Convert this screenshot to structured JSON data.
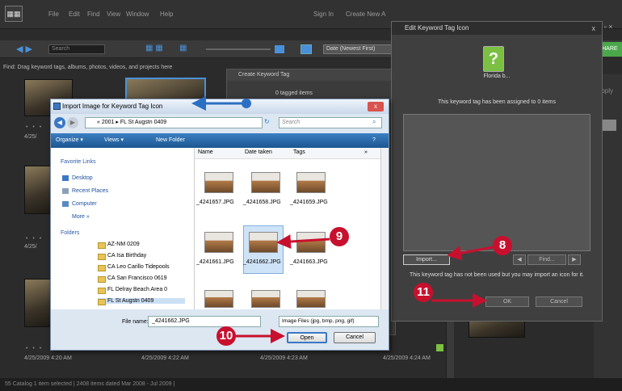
{
  "app": {
    "logo": "▦▦",
    "menu": [
      "File",
      "Edit",
      "Find",
      "View",
      "Window",
      "Help"
    ],
    "signin": "Sign In",
    "create_new": "Create New A",
    "search_placeholder": "Search",
    "sort": "Date (Newest First)",
    "find_bar": "Find: Drag keyword tags, albums, photos, videos, and projects here",
    "share": "SHARE",
    "apply": "Apply",
    "status": "55 Catalog   1 item selected  |  2408 items dated Mar 2008 - Jul 2009  |",
    "thumbs_dates": [
      "4/25/2009 4:20 AM",
      "4/25/2009 4:22 AM",
      "4/25/2009 4:23 AM",
      "4/25/2009 4:24 AM"
    ],
    "side_dates": [
      "4/25/",
      "4/25/"
    ]
  },
  "create_tag_dialog": {
    "title": "Create Keyword Tag",
    "count": "0 tagged items"
  },
  "edit_icon_dialog": {
    "title": "Edit Keyword Tag Icon",
    "close": "x",
    "tag_icon_glyph": "?",
    "tag_name": "Florida b...",
    "assigned_text": "This keyword tag has been assigned to 0 items",
    "import_label": "Import...",
    "prev": "◀",
    "find_label": "Find...",
    "next": "▶",
    "hint": "This keyword tag has not been used but you may import an icon for it.",
    "ok_label": "OK",
    "cancel_label": "Cancel"
  },
  "import_dialog": {
    "title": "Import Image for Keyword Tag Icon",
    "close": "x",
    "back": "◀",
    "forward": "▶",
    "address": "« 2001 ▸ FL St Augstn 0409",
    "search_placeholder": "Search",
    "organize": "Organize ▾",
    "views": "Views ▾",
    "new_folder": "New Folder",
    "favorite_links_header": "Favorite Links",
    "favorite_links": [
      "Desktop",
      "Recent Places",
      "Computer"
    ],
    "more": "More »",
    "folders_header": "Folders",
    "folders": [
      "AZ-NM 0209",
      "CA Isa Birthday",
      "CA Leo Carillo Tidepools",
      "CA San Francisco 0619",
      "FL Delray Beach Area 0",
      "FL St Augstn 0409"
    ],
    "columns": [
      "Name",
      "Date taken",
      "Tags",
      "»"
    ],
    "files_row1": [
      "_4241657.JPG",
      "_4241658.JPG",
      "_4241659.JPG"
    ],
    "files_row2": [
      "_4241661.JPG",
      "_4241662.JPG",
      "_4241663.JPG"
    ],
    "filename_label": "File name:",
    "filename_value": "_4241662.JPG",
    "type_label": "Image Files (jpg, bmp, png, gif)",
    "open_label": "Open",
    "cancel_label": "Cancel"
  },
  "callouts": [
    "8",
    "9",
    "10",
    "11"
  ]
}
